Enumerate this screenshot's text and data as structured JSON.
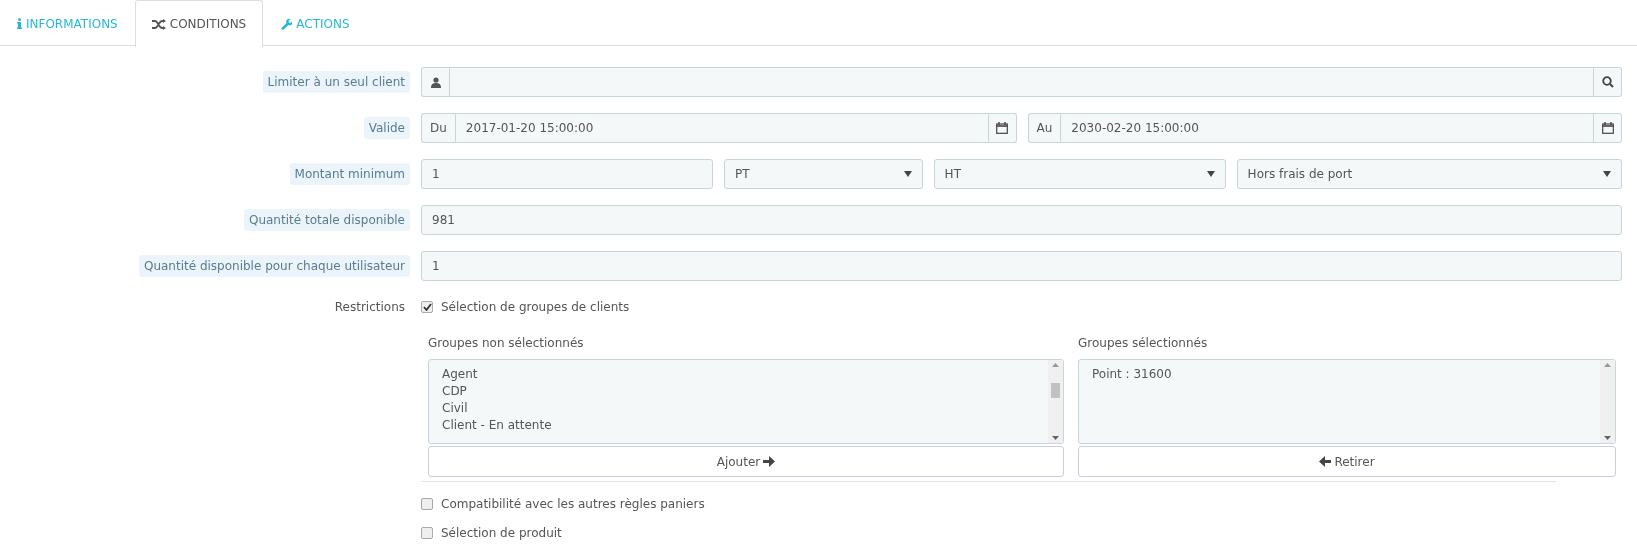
{
  "tabs": [
    {
      "label": "INFORMATIONS",
      "selected": false
    },
    {
      "label": "CONDITIONS",
      "selected": true
    },
    {
      "label": "ACTIONS",
      "selected": false
    }
  ],
  "fields": [
    {
      "kind": "search",
      "label": "Limiter à un seul client"
    },
    {
      "kind": "daterange",
      "label": "Valide",
      "from_prefix": "Du",
      "from": "2017-01-20 15:00:00",
      "to_prefix": "Au",
      "to": "2030-02-20 15:00:00"
    },
    {
      "kind": "amount",
      "label": "Montant minimum",
      "value": "1",
      "selects": [
        "PT",
        "HT",
        "Hors frais de port"
      ]
    },
    {
      "kind": "text",
      "label": "Quantité totale disponible",
      "value": "981"
    },
    {
      "kind": "text",
      "label": "Quantité disponible pour chaque utilisateur",
      "value": "1"
    }
  ],
  "restrictions": {
    "label": "Restrictions",
    "option": {
      "label": "Sélection de groupes de clients",
      "checked": true
    },
    "unselected_label": "Groupes non sélectionnés",
    "unselected": [
      "Agent",
      "CDP",
      "Civil",
      "Client - En attente"
    ],
    "add_button": "Ajouter",
    "selected_label": "Groupes sélectionnés",
    "selected": [
      "Point : 31600"
    ],
    "remove_button": "Retirer"
  },
  "extra_options": [
    {
      "label": "Compatibilité avec les autres règles paniers",
      "checked": false
    },
    {
      "label": "Sélection de produit",
      "checked": false
    }
  ]
}
